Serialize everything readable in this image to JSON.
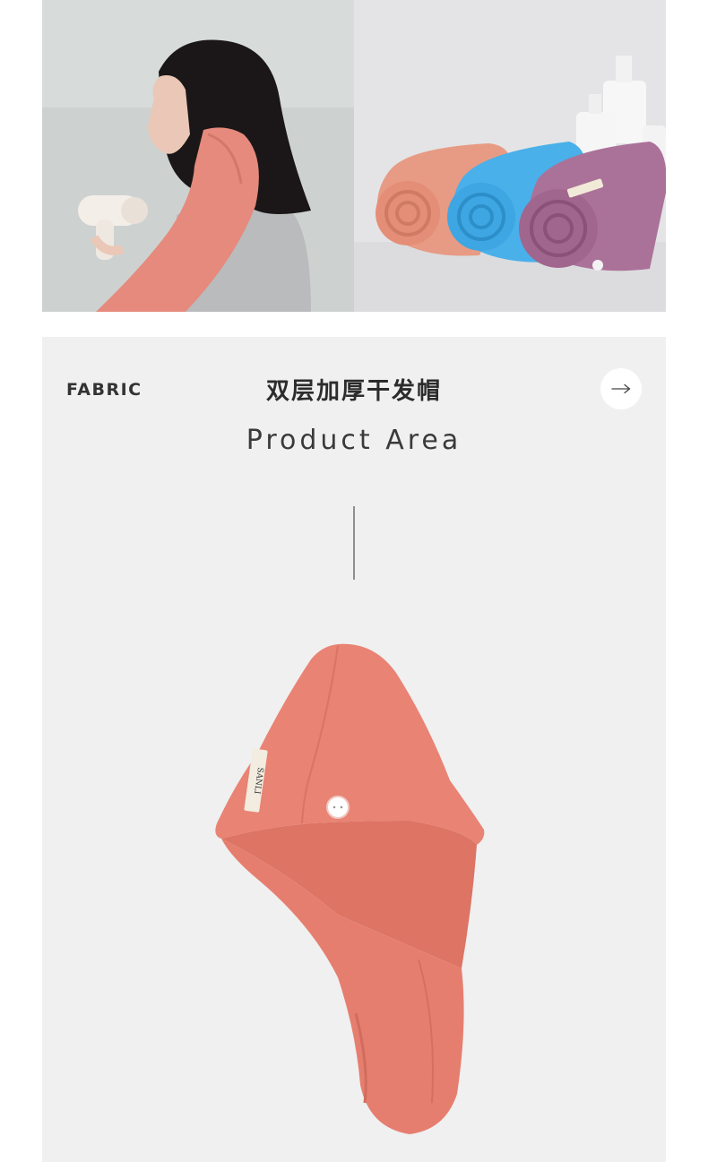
{
  "hero": {
    "left_image": "woman-wrapping-hair-in-pink-towel-with-hair-dryer",
    "right_image": "rolled-towels-peach-blue-purple"
  },
  "section": {
    "fabric_label": "FABRIC",
    "title": "双层加厚干发帽",
    "subtitle": "Product  Area",
    "next_icon": "arrow-right-icon"
  },
  "product": {
    "image": "coral-hair-drying-cap",
    "tag_text": "SANLI"
  },
  "colors": {
    "panel_bg": "#f0f0f0",
    "coral": "#e57d6c",
    "blue": "#3ea9e6",
    "purple": "#a36b91"
  }
}
